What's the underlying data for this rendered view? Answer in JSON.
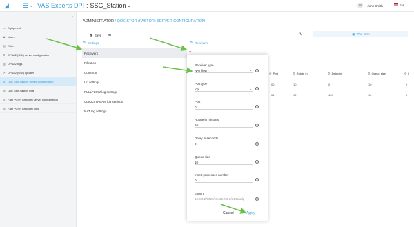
{
  "header": {
    "app_title": "VAS Experts DPI",
    "separator": ":",
    "station": "SSG_Station",
    "user_initials": "JS",
    "user_name": "John Smith",
    "language": "EN"
  },
  "sidebar": {
    "items": [
      {
        "label": "Equipment",
        "icon": "server-icon",
        "active": false
      },
      {
        "label": "Users",
        "icon": "users-icon",
        "active": false
      },
      {
        "label": "Roles",
        "icon": "roles-icon",
        "active": false
      },
      {
        "label": "DPIUI2 (GUI) server configuration",
        "icon": "settings-icon",
        "active": false
      },
      {
        "label": "DPIUI2 logs",
        "icon": "bar-chart-icon",
        "active": false
      },
      {
        "label": "DPIUI2 (GUI) updates",
        "icon": "update-icon",
        "active": false
      },
      {
        "label": "QoE Stor (fastor) server configuration",
        "icon": "settings-icon",
        "active": true
      },
      {
        "label": "QoE Stor (fastor) logs",
        "icon": "bar-chart-icon",
        "active": false
      },
      {
        "label": "Fast PCRF (fastpcrf) server configuration",
        "icon": "settings-icon",
        "active": false
      },
      {
        "label": "Fast PCRF (fastpcrf) logs",
        "icon": "bar-chart-icon",
        "active": false
      }
    ]
  },
  "breadcrumb": {
    "root": "ADMINISTRATOR",
    "sep": " / ",
    "current": "QOE STOR (FASTOR) SERVER CONFIGURATION"
  },
  "toolbar": {
    "save_label": "Save"
  },
  "tab_active": "The form",
  "settings_header": "Settings",
  "receivers_header": "Receivers",
  "settings_items": [
    "Receivers",
    "Filtration",
    "Common",
    "Uri settings",
    "FULLFLOW log settings",
    "CLICKSTREAM log settings",
    "NAT log settings"
  ],
  "table": {
    "columns": [
      "Port",
      "Rotate in",
      "Delay in",
      "Queue size",
      "I"
    ],
    "rows": [
      [
        "00",
        "10",
        "0",
        "10",
        "0"
      ],
      [
        "01",
        "12",
        "400",
        "10",
        "0"
      ]
    ]
  },
  "modal": {
    "fields": [
      {
        "label": "Receiver type",
        "value": "NAT flow",
        "dropdown": true
      },
      {
        "label": "Port type",
        "value": "tcp",
        "dropdown": true
      },
      {
        "label": "Port",
        "value": "0",
        "dropdown": false
      },
      {
        "label": "Rotate in minutes",
        "value": "10",
        "dropdown": false
      },
      {
        "label": "Delay in seconds",
        "value": "0",
        "dropdown": false
      },
      {
        "label": "Queue size",
        "value": "10",
        "dropdown": false
      },
      {
        "label": "Insert processes number",
        "value": "0",
        "dropdown": false
      },
      {
        "label": "Export",
        "value": "10.0.0.2/9920/tcp;10.0.0.3/3440/udp",
        "dropdown": false,
        "muted": true
      }
    ],
    "cancel_label": "Cancel",
    "apply_label": "Apply"
  },
  "colors": {
    "accent": "#38a0d8",
    "arrow": "#6cc04a"
  }
}
